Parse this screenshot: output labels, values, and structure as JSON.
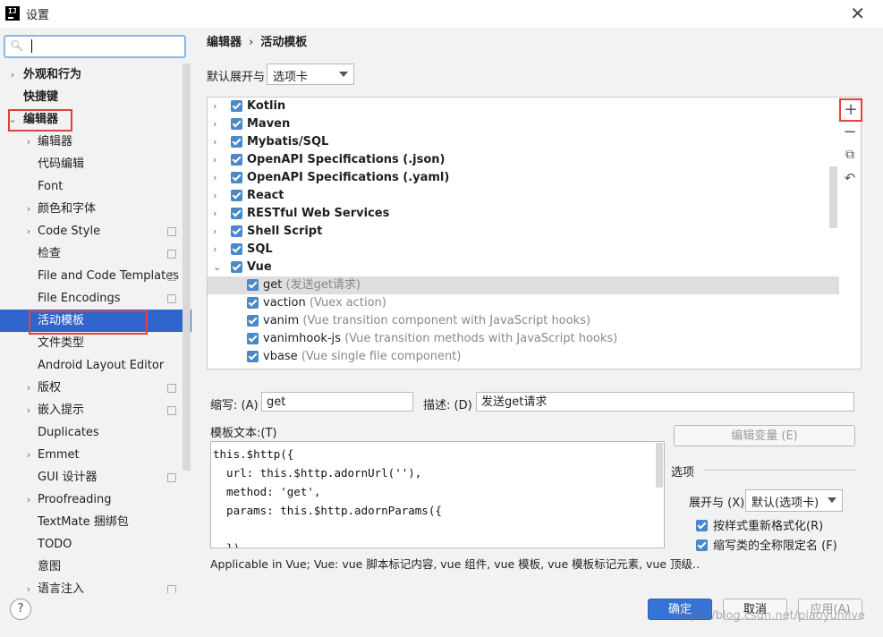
{
  "window": {
    "title": "设置"
  },
  "search": {
    "placeholder": ""
  },
  "sidebar": {
    "items": [
      {
        "label": "外观和行为",
        "expand": "›",
        "bold": true,
        "badge": false
      },
      {
        "label": "快捷键",
        "expand": "",
        "bold": true,
        "badge": false
      },
      {
        "label": "编辑器",
        "expand": "⌄",
        "bold": true,
        "badge": false
      },
      {
        "label": "编辑器",
        "expand": "›",
        "bold": false,
        "badge": false
      },
      {
        "label": "代码编辑",
        "expand": "",
        "bold": false,
        "badge": false
      },
      {
        "label": "Font",
        "expand": "",
        "bold": false,
        "badge": false
      },
      {
        "label": "颜色和字体",
        "expand": "›",
        "bold": false,
        "badge": false
      },
      {
        "label": "Code Style",
        "expand": "›",
        "bold": false,
        "badge": true
      },
      {
        "label": "检查",
        "expand": "",
        "bold": false,
        "badge": true
      },
      {
        "label": "File and Code Templates",
        "expand": "",
        "bold": false,
        "badge": true
      },
      {
        "label": "File Encodings",
        "expand": "",
        "bold": false,
        "badge": true
      },
      {
        "label": "活动模板",
        "expand": "",
        "bold": false,
        "badge": false,
        "selected": true
      },
      {
        "label": "文件类型",
        "expand": "",
        "bold": false,
        "badge": false
      },
      {
        "label": "Android Layout Editor",
        "expand": "",
        "bold": false,
        "badge": false
      },
      {
        "label": "版权",
        "expand": "›",
        "bold": false,
        "badge": true
      },
      {
        "label": "嵌入提示",
        "expand": "›",
        "bold": false,
        "badge": true
      },
      {
        "label": "Duplicates",
        "expand": "",
        "bold": false,
        "badge": false
      },
      {
        "label": "Emmet",
        "expand": "›",
        "bold": false,
        "badge": false
      },
      {
        "label": "GUI 设计器",
        "expand": "",
        "bold": false,
        "badge": true
      },
      {
        "label": "Proofreading",
        "expand": "›",
        "bold": false,
        "badge": false
      },
      {
        "label": "TextMate 捆绑包",
        "expand": "",
        "bold": false,
        "badge": false
      },
      {
        "label": "TODO",
        "expand": "",
        "bold": false,
        "badge": false
      },
      {
        "label": "意图",
        "expand": "",
        "bold": false,
        "badge": false
      },
      {
        "label": "语言注入",
        "expand": "›",
        "bold": false,
        "badge": true
      }
    ]
  },
  "breadcrumb": {
    "part1": "编辑器",
    "sep": "›",
    "part2": "活动模板"
  },
  "expand_by": {
    "label": "默认展开与",
    "value": "选项卡"
  },
  "templates": {
    "groups": [
      {
        "name": "Kotlin",
        "expand": "›"
      },
      {
        "name": "Maven",
        "expand": "›"
      },
      {
        "name": "Mybatis/SQL",
        "expand": "›"
      },
      {
        "name": "OpenAPI Specifications (.json)",
        "expand": "›"
      },
      {
        "name": "OpenAPI Specifications (.yaml)",
        "expand": "›"
      },
      {
        "name": "React",
        "expand": "›"
      },
      {
        "name": "RESTful Web Services",
        "expand": "›"
      },
      {
        "name": "Shell Script",
        "expand": "›"
      },
      {
        "name": "SQL",
        "expand": "›"
      },
      {
        "name": "Vue",
        "expand": "⌄"
      }
    ],
    "vue_items": [
      {
        "name": "get",
        "desc": "(发送get请求)",
        "highlight": true
      },
      {
        "name": "vaction",
        "desc": "(Vuex action)",
        "highlight": false
      },
      {
        "name": "vanim",
        "desc": "(Vue transition component with JavaScript hooks)",
        "highlight": false
      },
      {
        "name": "vanimhook-js",
        "desc": "(Vue transition methods with JavaScript hooks)",
        "highlight": false
      },
      {
        "name": "vbase",
        "desc": "(Vue single file component)",
        "highlight": false
      }
    ]
  },
  "side_buttons": {
    "add": "+",
    "remove": "−",
    "copy": "⧉",
    "revert": "↶"
  },
  "form": {
    "abbr_label": "缩写: (A)",
    "abbr_value": "get",
    "desc_label": "描述: (D)",
    "desc_value": "发送get请求",
    "template_label": "模板文本:(T)",
    "template_text": "this.$http({\n  url: this.$http.adornUrl(''),\n  method: 'get',\n  params: this.$http.adornParams({\n\n  })",
    "edit_vars": "编辑变量 (E)",
    "options_title": "选项",
    "expand_with_label": "展开与 (X)",
    "expand_with_value": "默认(选项卡)",
    "reformat": "按样式重新格式化(R)",
    "shorten_fq": "缩写类的全称限定名 (F)",
    "applicable": "Applicable in Vue; Vue: vue 脚本标记内容, vue 组件, vue 模板, vue 模板标记元素, vue 顶级.."
  },
  "footer": {
    "help": "?",
    "ok": "确定",
    "cancel": "取消",
    "apply": "应用(A)"
  },
  "watermark": "https://blog.csdn.net/piaoyunlive",
  "colors": {
    "accent": "#2f65ca",
    "highlight_box": "#e53e3e",
    "checkbox": "#4a88c7"
  }
}
